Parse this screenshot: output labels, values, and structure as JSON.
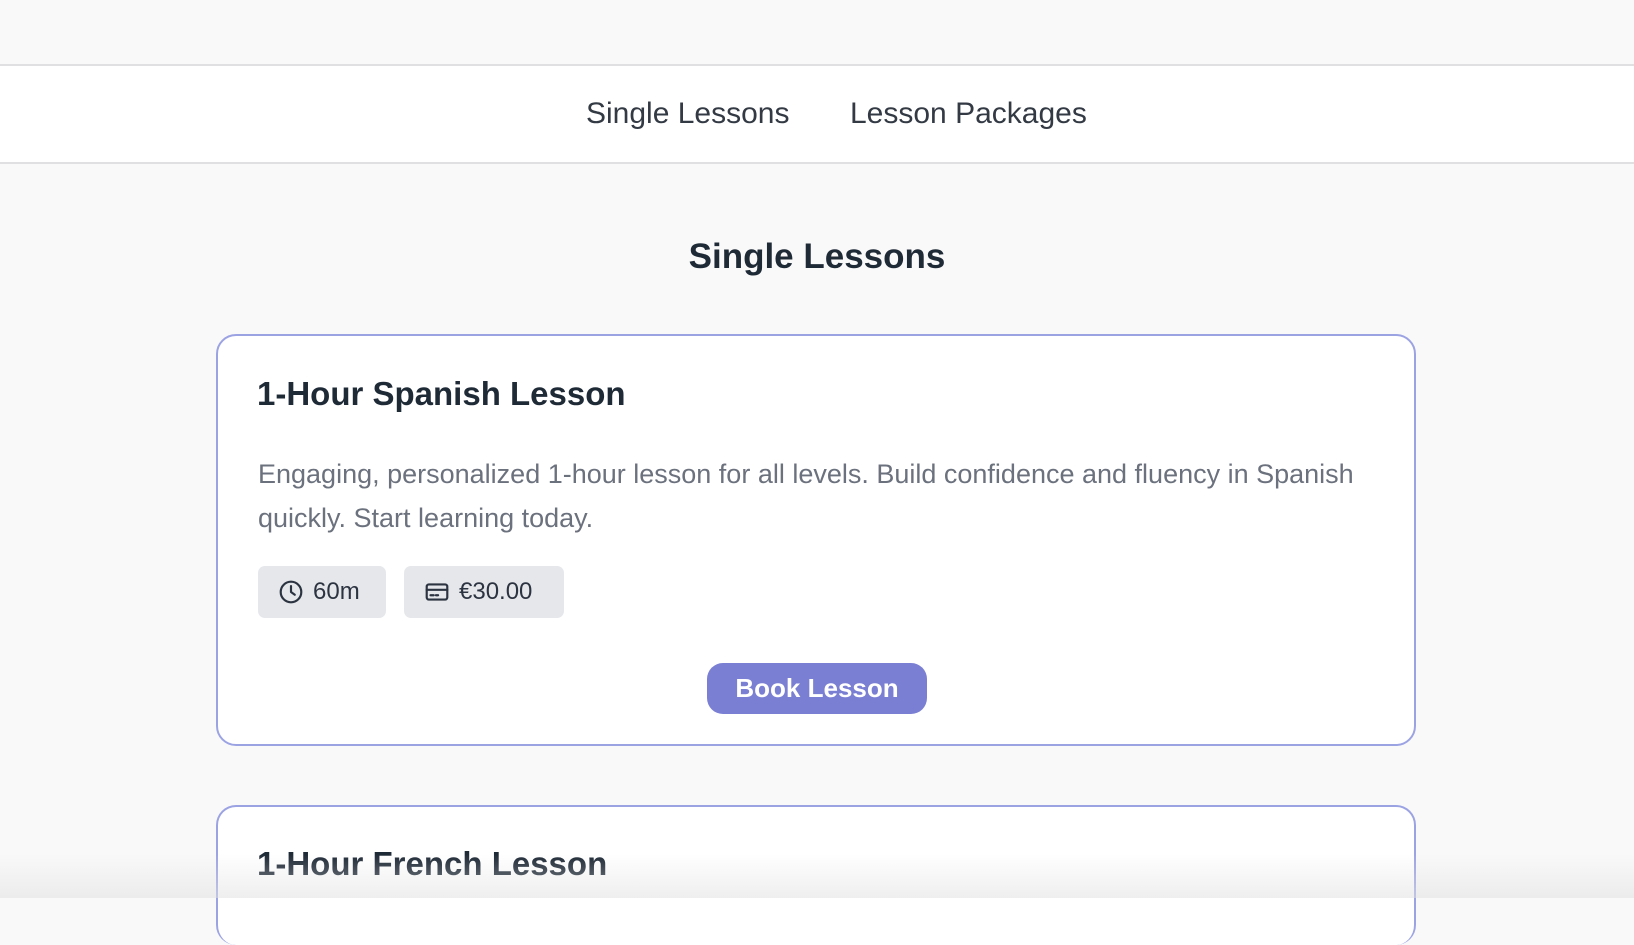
{
  "nav": {
    "tabs": [
      {
        "label": "Single Lessons"
      },
      {
        "label": "Lesson Packages"
      }
    ]
  },
  "section": {
    "title": "Single Lessons"
  },
  "lessons": [
    {
      "title": "1-Hour Spanish Lesson",
      "description": "Engaging, personalized 1-hour lesson for all levels. Build confidence and fluency in Spanish quickly. Start learning today.",
      "duration": "60m",
      "price": "€30.00",
      "button_label": "Book Lesson",
      "duration_icon": "clock-icon",
      "price_icon": "credit-card-icon"
    },
    {
      "title": "1-Hour French Lesson"
    }
  ],
  "colors": {
    "accent": "#7a7fd3",
    "card_border": "#9ca3e3",
    "chip_bg": "#e5e7eb",
    "title_text": "#1f2a37",
    "body_text": "#6b717d"
  }
}
